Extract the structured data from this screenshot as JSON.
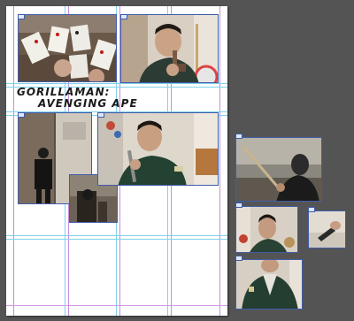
{
  "document": {
    "title_line1": "GORILLAMAN:",
    "title_line2": "AVENGING APE"
  },
  "colors": {
    "pasteboard": "#545454",
    "page": "#ffffff",
    "frame_border": "#3f5ca8",
    "margin_guide": "#c88be0",
    "column_guide": "#85d0ea"
  },
  "icons": {
    "frame_handle": "frame-handle-icon"
  }
}
